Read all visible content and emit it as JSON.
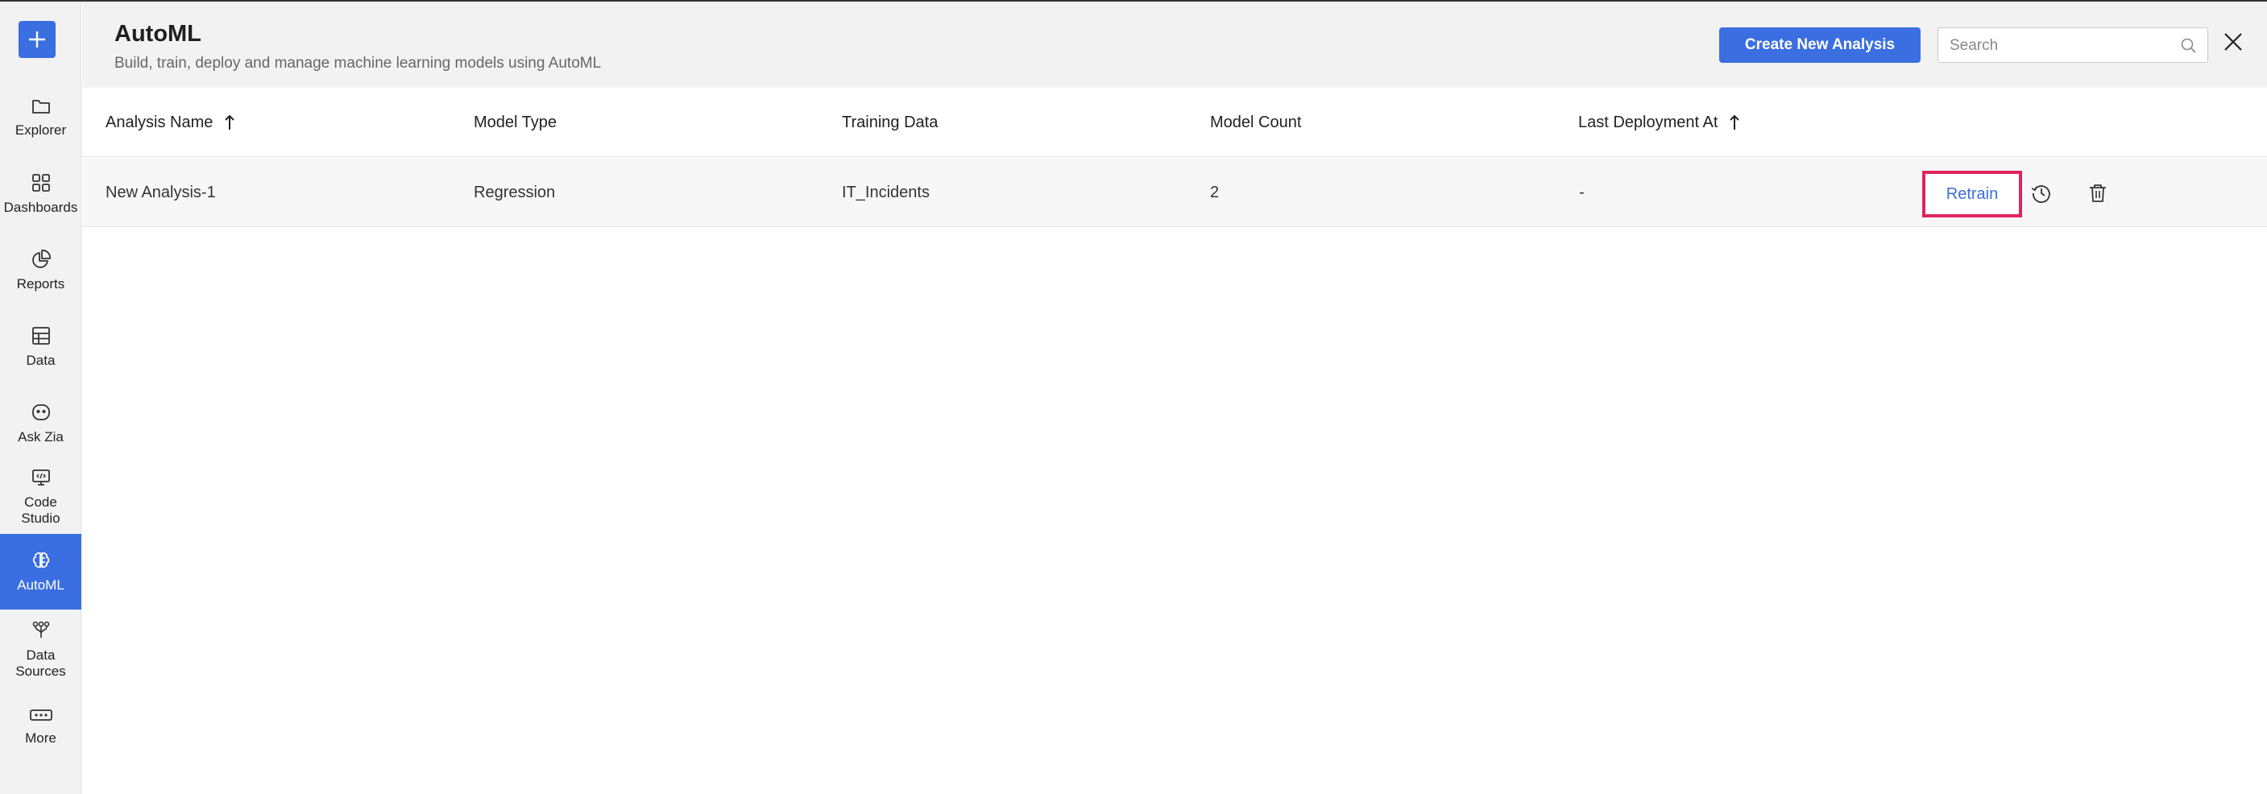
{
  "app": {
    "title": "AutoML",
    "subtitle": "Build, train, deploy and manage machine learning models using AutoML",
    "accent_color": "#3b6ee0",
    "highlight_color": "#e0245e"
  },
  "sidebar": {
    "add_icon": "plus-icon",
    "items": [
      {
        "label": "Explorer",
        "icon": "folder-icon"
      },
      {
        "label": "Dashboards",
        "icon": "grid-icon"
      },
      {
        "label": "Reports",
        "icon": "pie-chart-icon"
      },
      {
        "label": "Data",
        "icon": "table-icon"
      },
      {
        "label": "Ask Zia",
        "icon": "zia-icon"
      },
      {
        "label": "Code\nStudio",
        "icon": "code-icon"
      },
      {
        "label": "AutoML",
        "icon": "brain-icon",
        "active": true
      },
      {
        "label": "Data\nSources",
        "icon": "data-sources-icon"
      },
      {
        "label": "More",
        "icon": "more-icon"
      }
    ]
  },
  "header": {
    "create_label": "Create New Analysis",
    "search_placeholder": "Search",
    "close_icon": "close-icon"
  },
  "table": {
    "columns": [
      {
        "label": "Analysis Name",
        "sortable": true
      },
      {
        "label": "Model Type"
      },
      {
        "label": "Training Data"
      },
      {
        "label": "Model Count"
      },
      {
        "label": "Last Deployment At",
        "sortable": true
      }
    ],
    "rows": [
      {
        "analysis_name": "New Analysis-1",
        "model_type": "Regression",
        "training_data": "IT_Incidents",
        "model_count": "2",
        "last_deployment": "-",
        "action_label": "Retrain"
      }
    ]
  }
}
